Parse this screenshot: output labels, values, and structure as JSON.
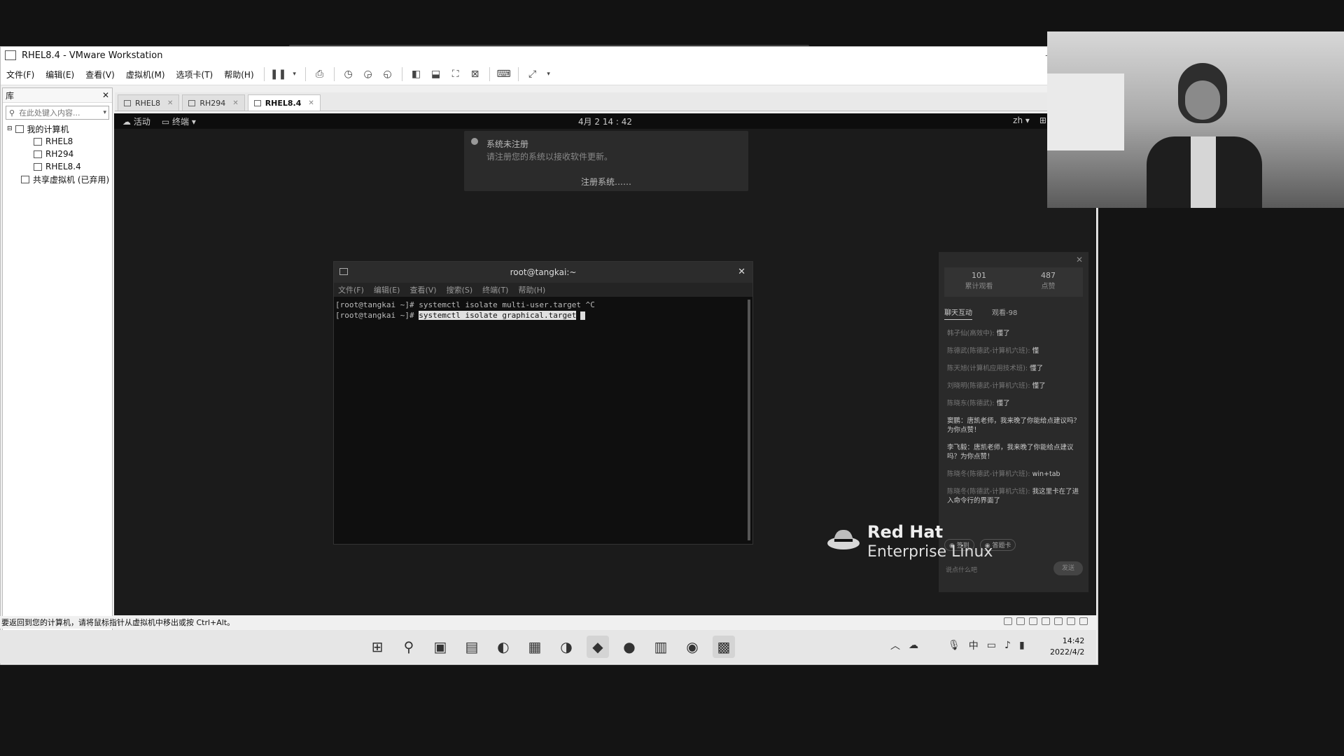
{
  "vmware": {
    "title": "RHEL8.4 - VMware Workstation",
    "menus": [
      "文件(F)",
      "编辑(E)",
      "查看(V)",
      "虚拟机(M)",
      "选项卡(T)",
      "帮助(H)"
    ],
    "library": {
      "header": "库",
      "search_placeholder": "在此处键入内容...",
      "tree_root": "我的计算机",
      "vms": [
        "RHEL8",
        "RH294",
        "RHEL8.4"
      ],
      "shared": "共享虚拟机 (已弃用)"
    },
    "tabs": [
      "RHEL8",
      "RH294",
      "RHEL8.4"
    ],
    "active_tab": "RHEL8.4",
    "status_text": "要返回到您的计算机，请将鼠标指针从虚拟机中移出或按 Ctrl+Alt。"
  },
  "gnome": {
    "activities": "活动",
    "terminal_menu": "终端",
    "clock": "4月 2 14 : 42",
    "lang": "zh"
  },
  "notification": {
    "title": "系统未注册",
    "body": "请注册您的系统以接收软件更新。",
    "action": "注册系统……"
  },
  "terminal": {
    "title": "root@tangkai:~",
    "menus": [
      "文件(F)",
      "编辑(E)",
      "查看(V)",
      "搜索(S)",
      "终端(T)",
      "帮助(H)"
    ],
    "line1_prompt": "[root@tangkai ~]#",
    "line1_cmd": " systemctl isolate multi-user.target ^C",
    "line2_prompt": "[root@tangkai ~]#",
    "line2_cmd": "systemctl isolate graphical.target"
  },
  "chat": {
    "stats": [
      {
        "num": "101",
        "label": "累计观看"
      },
      {
        "num": "487",
        "label": "点赞"
      }
    ],
    "tabs": [
      "聊天互动",
      "观看-98"
    ],
    "messages": [
      {
        "user": "韩子仙(高效中):",
        "text": "懂了"
      },
      {
        "user": "陈德武(陈德武-计算机六班):",
        "text": "懂"
      },
      {
        "user": "陈天旭(计算机应用技术班):",
        "text": "懂了"
      },
      {
        "user": "刘晓明(陈德武-计算机六班):",
        "text": "懂了"
      },
      {
        "user": "陈晓东(陈德武):",
        "text": "懂了"
      },
      {
        "user": "",
        "text": "窦鹏：唐凯老师，我来晚了你能给点建议吗？为你点赞！"
      },
      {
        "user": "",
        "text": "李飞毅：唐凯老师，我来晚了你能给点建议吗？为你点赞！"
      },
      {
        "user": "陈晓冬(陈德武-计算机六班):",
        "text": "win+tab"
      },
      {
        "user": "陈晓冬(陈德武-计算机六班):",
        "text": "我这里卡在了进入命令行的界面了"
      }
    ],
    "chips": [
      "签到",
      "答题卡"
    ],
    "input_placeholder": "说点什么吧",
    "send": "发送"
  },
  "redhat": {
    "line1": "Red Hat",
    "line2": "Enterprise Linux"
  },
  "taskbar": {
    "time": "14:42",
    "date": "2022/4/2",
    "ime": "中"
  },
  "colors": {
    "vm_bg": "#1b1b1b",
    "terminal_bg": "#0f0f0f",
    "highlight": "#e0e0e0",
    "chrome": "#f0f0f0"
  }
}
